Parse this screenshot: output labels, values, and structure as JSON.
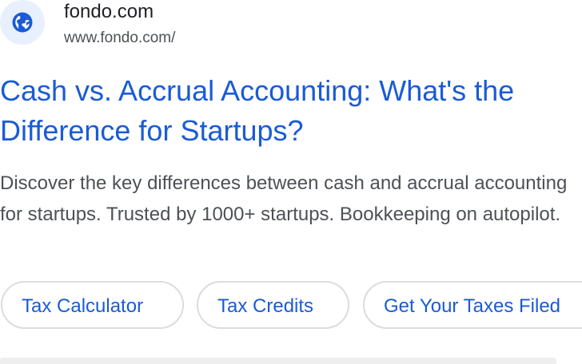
{
  "site": {
    "name": "fondo.com",
    "url": "www.fondo.com/",
    "favicon_icon": "globe-icon"
  },
  "result": {
    "title": "Cash vs. Accrual Accounting: What's the Difference for Startups?",
    "snippet": "Discover the key differences between cash and accrual accounting for startups. Trusted by 1000+ startups. Bookkeeping on autopilot."
  },
  "sitelinks": [
    {
      "label": "Tax Calculator"
    },
    {
      "label": "Tax Credits"
    },
    {
      "label": "Get Your Taxes Filed"
    }
  ],
  "colors": {
    "link": "#1a5bd4",
    "text": "#4d5156",
    "site_name": "#202124",
    "favicon_bg": "#e8f0fe",
    "globe": "#1a5bd4"
  }
}
